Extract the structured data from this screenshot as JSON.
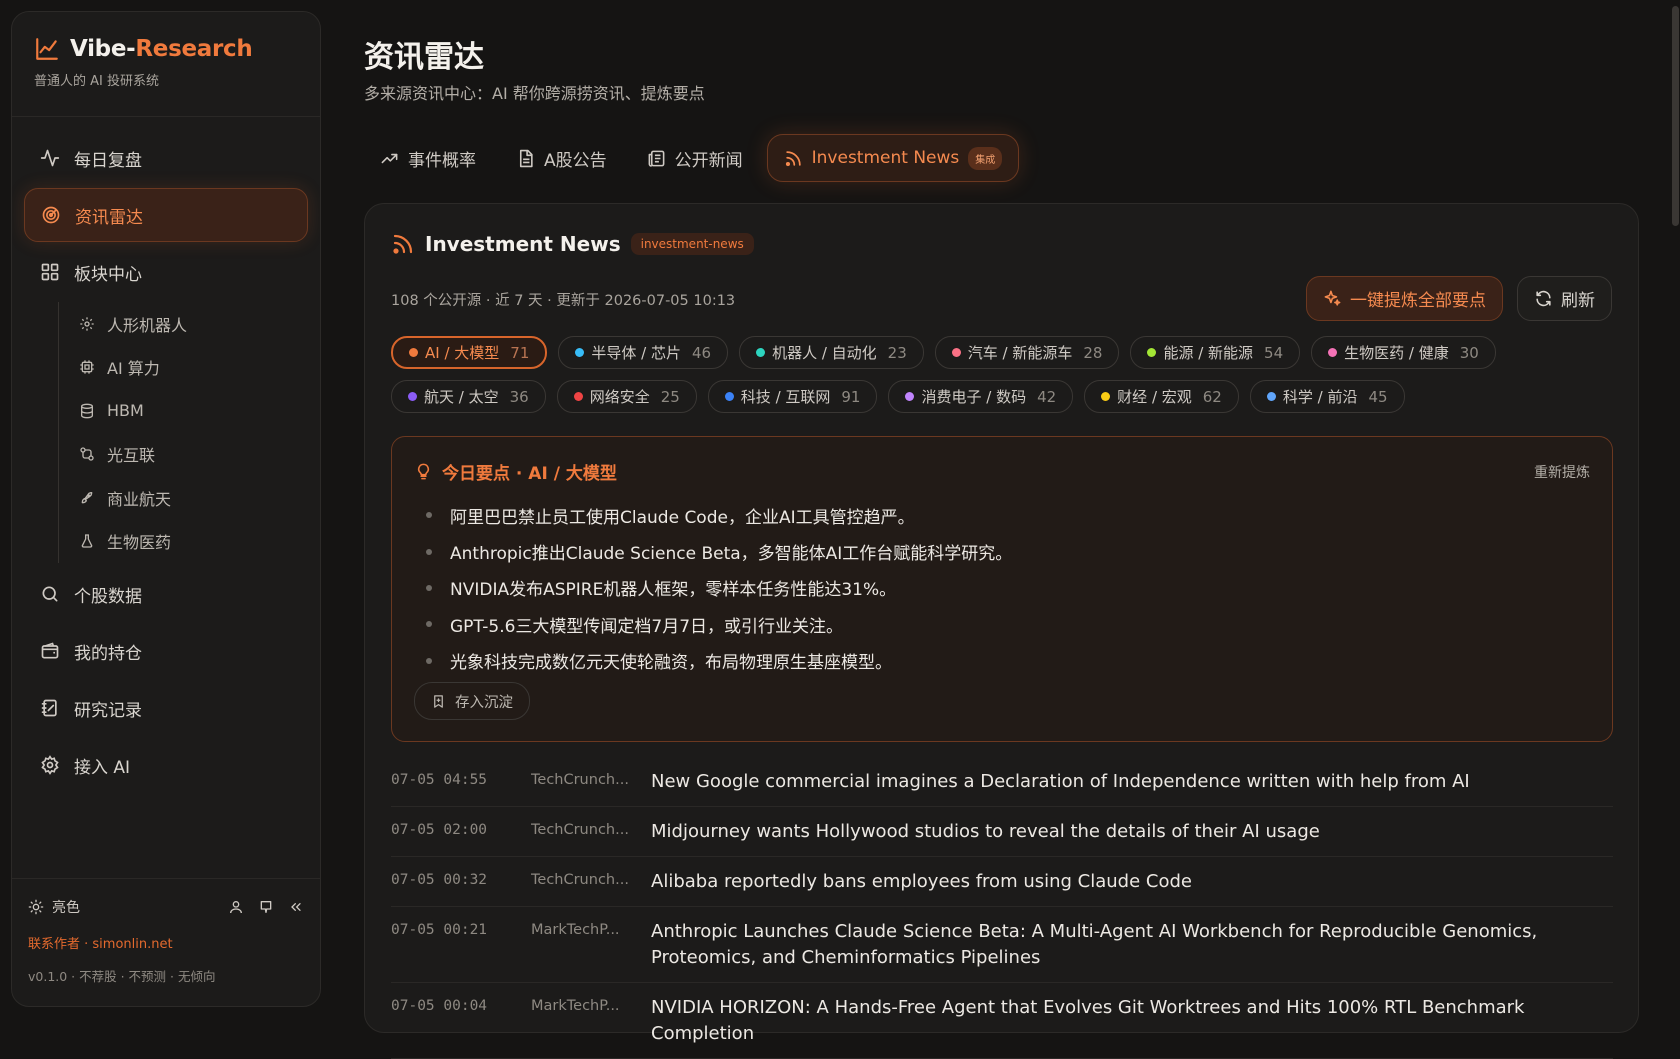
{
  "sidebar": {
    "brand": {
      "name_a": "Vibe-",
      "name_b": "Research",
      "subtitle": "普通人的 AI 投研系统"
    },
    "nav": [
      {
        "label": "每日复盘",
        "icon": "activity-icon"
      },
      {
        "label": "资讯雷达",
        "icon": "radar-icon",
        "active": true
      },
      {
        "label": "板块中心",
        "icon": "grid-icon"
      }
    ],
    "sub": [
      {
        "label": "人形机器人",
        "icon": "gear-icon"
      },
      {
        "label": "AI 算力",
        "icon": "cpu-icon"
      },
      {
        "label": "HBM",
        "icon": "database-icon"
      },
      {
        "label": "光互联",
        "icon": "link-icon"
      },
      {
        "label": "商业航天",
        "icon": "rocket-icon"
      },
      {
        "label": "生物医药",
        "icon": "flask-icon"
      }
    ],
    "nav2": [
      {
        "label": "个股数据",
        "icon": "search-icon"
      },
      {
        "label": "我的持仓",
        "icon": "wallet-icon"
      },
      {
        "label": "研究记录",
        "icon": "notebook-icon"
      },
      {
        "label": "接入 AI",
        "icon": "settings-icon"
      }
    ],
    "footer": {
      "theme": "亮色",
      "contact": "联系作者 · simonlin.net",
      "version": "v0.1.0 · 不荐股 · 不预测 · 无倾向"
    }
  },
  "header": {
    "title": "资讯雷达",
    "subtitle": "多来源资讯中心：AI 帮你跨源捞资讯、提炼要点"
  },
  "tabs": [
    {
      "label": "事件概率",
      "icon": "trending-icon"
    },
    {
      "label": "A股公告",
      "icon": "file-icon"
    },
    {
      "label": "公开新闻",
      "icon": "newspaper-icon"
    },
    {
      "label": "Investment News",
      "icon": "rss-icon",
      "badge": "集成",
      "active": true
    }
  ],
  "panel": {
    "title": "Investment News",
    "tag": "investment-news",
    "meta": "108 个公开源 · 近 7 天 · 更新于 2026-07-05 10:13",
    "extract_label": "一键提炼全部要点",
    "refresh_label": "刷新"
  },
  "chips": [
    {
      "label": "AI / 大模型",
      "count": "71",
      "color": "#f07a3d",
      "active": true
    },
    {
      "label": "半导体 / 芯片",
      "count": "46",
      "color": "#38bdf8"
    },
    {
      "label": "机器人 / 自动化",
      "count": "23",
      "color": "#2dd4bf"
    },
    {
      "label": "汽车 / 新能源车",
      "count": "28",
      "color": "#fb7185"
    },
    {
      "label": "能源 / 新能源",
      "count": "54",
      "color": "#a3e635"
    },
    {
      "label": "生物医药 / 健康",
      "count": "30",
      "color": "#f472b6"
    },
    {
      "label": "航天 / 太空",
      "count": "36",
      "color": "#8b5cf6"
    },
    {
      "label": "网络安全",
      "count": "25",
      "color": "#ef4444"
    },
    {
      "label": "科技 / 互联网",
      "count": "91",
      "color": "#3b82f6"
    },
    {
      "label": "消费电子 / 数码",
      "count": "42",
      "color": "#c084fc"
    },
    {
      "label": "财经 / 宏观",
      "count": "62",
      "color": "#facc15"
    },
    {
      "label": "科学 / 前沿",
      "count": "45",
      "color": "#60a5fa"
    }
  ],
  "summary": {
    "title": "今日要点 · AI / 大模型",
    "regen_label": "重新提炼",
    "save_label": "存入沉淀",
    "points": [
      "阿里巴巴禁止员工使用Claude Code，企业AI工具管控趋严。",
      "Anthropic推出Claude Science Beta，多智能体AI工作台赋能科学研究。",
      "NVIDIA发布ASPIRE机器人框架，零样本任务性能达31%。",
      "GPT-5.6三大模型传闻定档7月7日，或引行业关注。",
      "光象科技完成数亿元天使轮融资，布局物理原生基座模型。"
    ]
  },
  "news": [
    {
      "time": "07-05 04:55",
      "source": "TechCrunch...",
      "title": "New Google commercial imagines a Declaration of Independence written with help from AI"
    },
    {
      "time": "07-05 02:00",
      "source": "TechCrunch...",
      "title": "Midjourney wants Hollywood studios to reveal the details of their AI usage"
    },
    {
      "time": "07-05 00:32",
      "source": "TechCrunch...",
      "title": "Alibaba reportedly bans employees from using Claude Code"
    },
    {
      "time": "07-05 00:21",
      "source": "MarkTechP...",
      "title": "Anthropic Launches Claude Science Beta: A Multi-Agent AI Workbench for Reproducible Genomics, Proteomics, and Cheminformatics Pipelines"
    },
    {
      "time": "07-05 00:04",
      "source": "MarkTechP...",
      "title": "NVIDIA HORIZON: A Hands-Free Agent that Evolves Git Worktrees and Hits 100% RTL Benchmark Completion"
    }
  ]
}
